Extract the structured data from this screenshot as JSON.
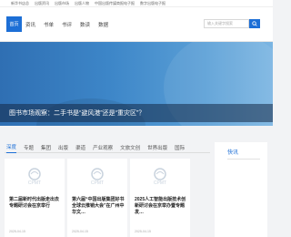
{
  "topbar": {
    "links": [
      "新华书店总",
      "出版资讯",
      "出版市场",
      "出版人物",
      "中国出版传媒商报电子报",
      "数字出版电子报"
    ]
  },
  "header": {
    "brand_tab": "首页",
    "nav": [
      "资讯",
      "书单",
      "书评",
      "数读",
      "数据"
    ],
    "search_placeholder": "输入关键字搜索"
  },
  "hero": {
    "caption": "图书市场观察：二手书是“避风港”还是“重灾区”？"
  },
  "main": {
    "tabs": [
      "深度",
      "专题",
      "集团",
      "出版",
      "渠道",
      "产业观察",
      "文旅文创",
      "世界出版",
      "国际"
    ],
    "active_tab": "深度",
    "cards": [
      {
        "title": "第二届新时代出版走出去专题研讨会在京举行",
        "date": "2025-04-15"
      },
      {
        "title": "第六届“中国出版集团好书全球云推销大会”在广州中华文…",
        "date": "2025-04-15"
      },
      {
        "title": "2025人工智能出版技术创新研讨会在京举办暨专题发…",
        "date": "2025-04-15"
      }
    ]
  },
  "sidebar": {
    "title": "快讯"
  },
  "colors": {
    "accent": "#1d6fd6"
  }
}
